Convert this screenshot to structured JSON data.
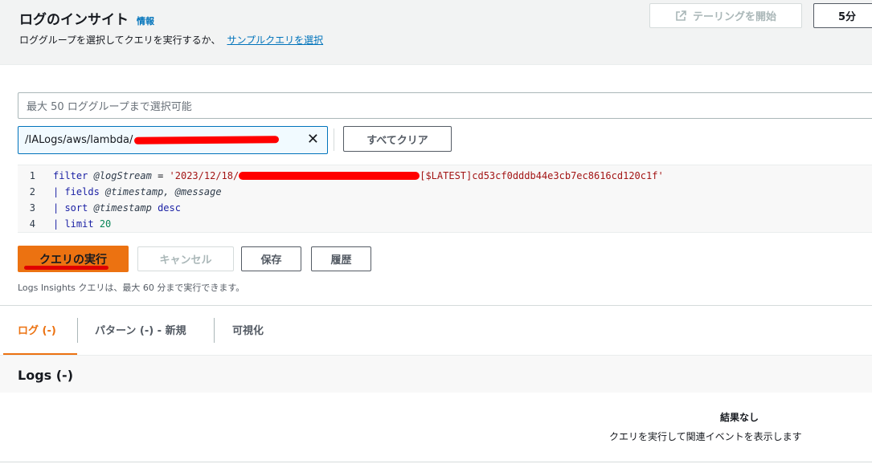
{
  "header": {
    "title": "ログのインサイト",
    "info_link": "情報",
    "subtitle": "ロググループを選択してクエリを実行するか、",
    "sample_link": "サンプルクエリを選択",
    "tail_button": "テーリングを開始",
    "time_button": "5分"
  },
  "log_groups": {
    "placeholder": "最大 50 ロググループまで選択可能",
    "selected_token": "/IALogs/aws/lambda/",
    "clear_all": "すべてクリア"
  },
  "editor": {
    "lines": [
      {
        "no": "1",
        "kw": "filter",
        "var": "@logStream",
        "op": " = ",
        "str_start": "'2023/12/18/",
        "str_end": "[$LATEST]cd53cf0dddb44e3cb7ec8616cd120c1f'"
      },
      {
        "no": "2",
        "pipe": "| ",
        "kw": "fields",
        "rest": "@timestamp, @message"
      },
      {
        "no": "3",
        "pipe": "| ",
        "kw": "sort",
        "var": "@timestamp",
        "kw2": "desc"
      },
      {
        "no": "4",
        "pipe": "| ",
        "kw": "limit",
        "num": "20"
      }
    ]
  },
  "actions": {
    "run": "クエリの実行",
    "cancel": "キャンセル",
    "save": "保存",
    "history": "履歴",
    "note": "Logs Insights クエリは、最大 60 分まで実行できます。"
  },
  "tabs": [
    {
      "label": "ログ (-)"
    },
    {
      "label": "パターン (-) - 新規"
    },
    {
      "label": "可視化"
    }
  ],
  "results": {
    "title": "Logs (-)",
    "empty_title": "結果なし",
    "empty_desc": "クエリを実行して関連イベントを表示します"
  },
  "colors": {
    "accent": "#ec7211",
    "link": "#0073bb",
    "redaction": "#ff0000"
  }
}
